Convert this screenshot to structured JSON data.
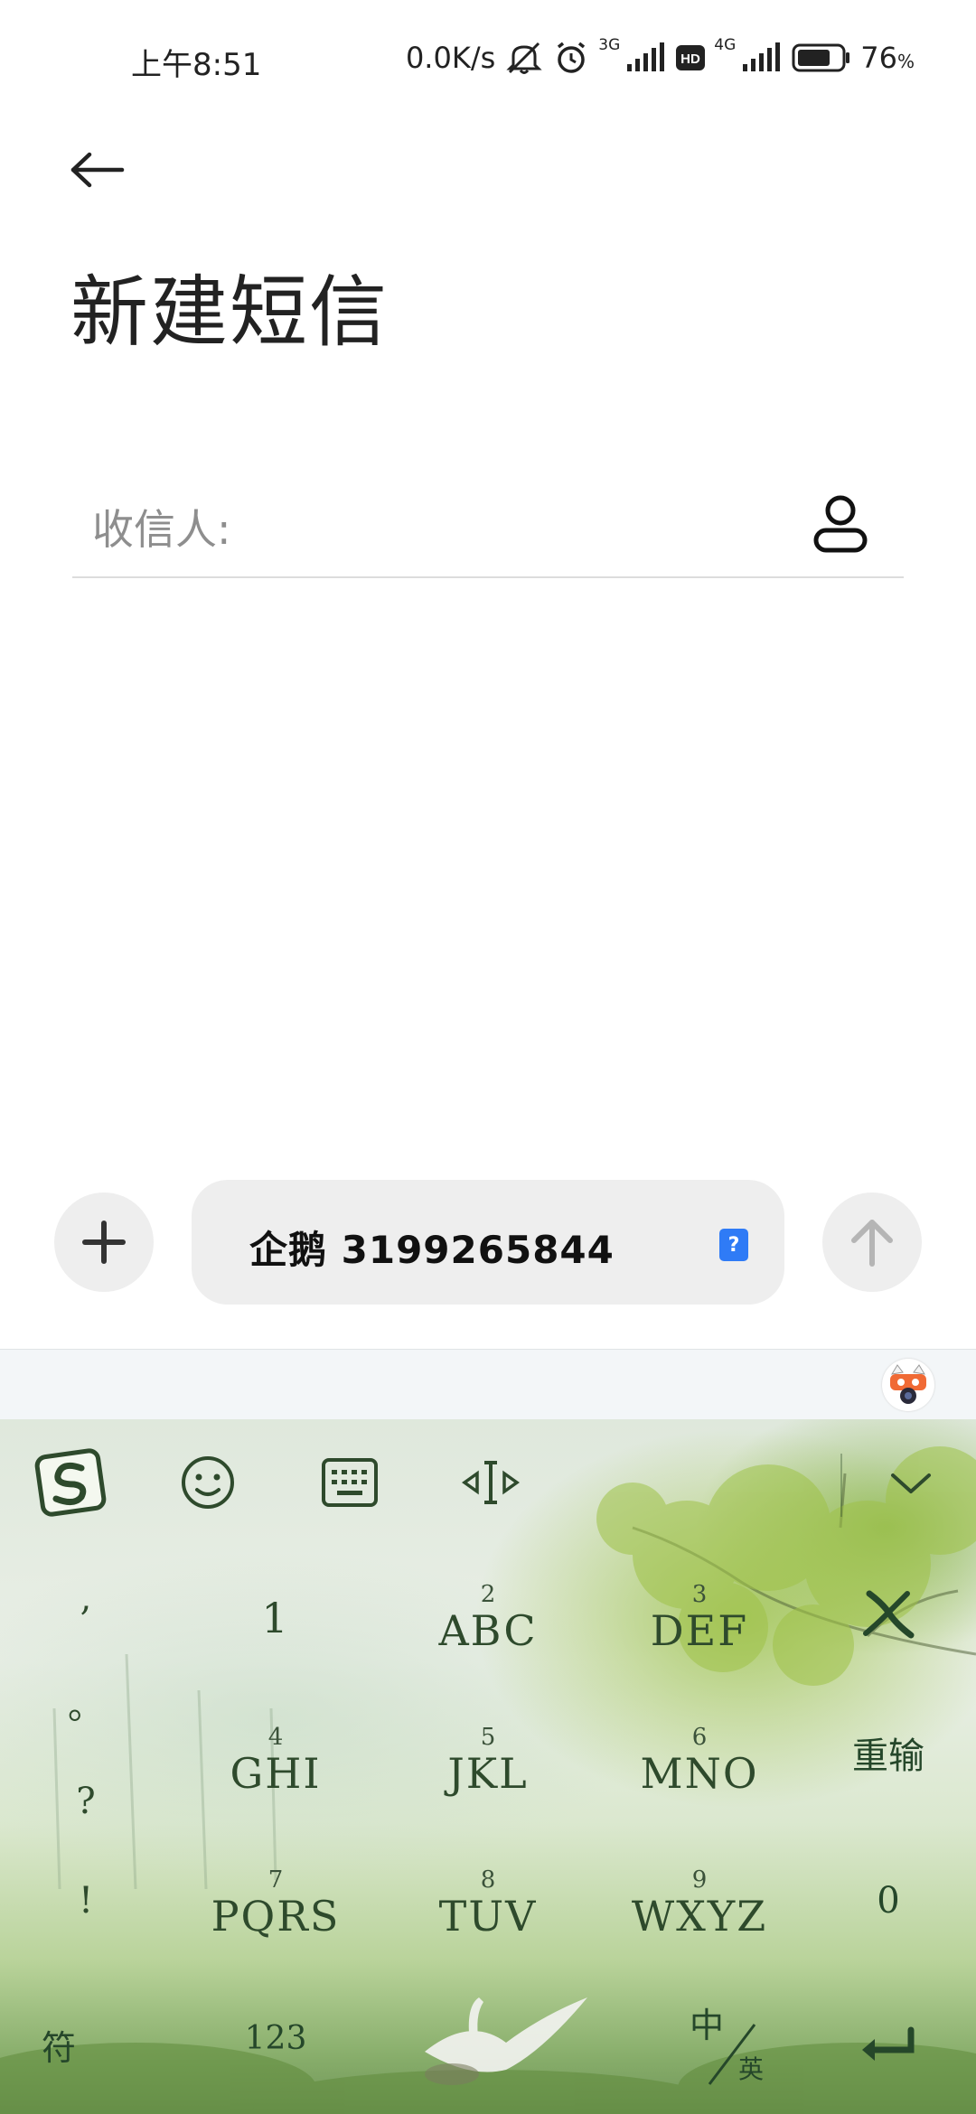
{
  "status_bar": {
    "time": "上午8:51",
    "net_speed": "0.0K/s",
    "sim1_label": "3G",
    "hd_label": "HD",
    "sim2_label": "4G",
    "battery_pct": "76",
    "battery_unit": "%",
    "battery_level": 0.76
  },
  "header": {
    "title": "新建短信"
  },
  "recipient": {
    "label": "收信人:"
  },
  "compose": {
    "message_text": "企鹅 3199265844",
    "badge": "?"
  },
  "keyboard": {
    "punctuation": [
      ",",
      "。",
      "?",
      "!"
    ],
    "keys": [
      {
        "num": "",
        "letters": "1"
      },
      {
        "num": "2",
        "letters": "ABC"
      },
      {
        "num": "3",
        "letters": "DEF"
      },
      {
        "num": "4",
        "letters": "GHI"
      },
      {
        "num": "5",
        "letters": "JKL"
      },
      {
        "num": "6",
        "letters": "MNO"
      },
      {
        "num": "7",
        "letters": "PQRS"
      },
      {
        "num": "8",
        "letters": "TUV"
      },
      {
        "num": "9",
        "letters": "WXYZ"
      }
    ],
    "retype_label": "重输",
    "zero_label": "0",
    "symbol_label": "符",
    "num_mode_label": "123",
    "lang_zh": "中",
    "lang_en": "英",
    "colors": {
      "ink": "#2e4a2c",
      "foliage": "#96be3c"
    }
  }
}
